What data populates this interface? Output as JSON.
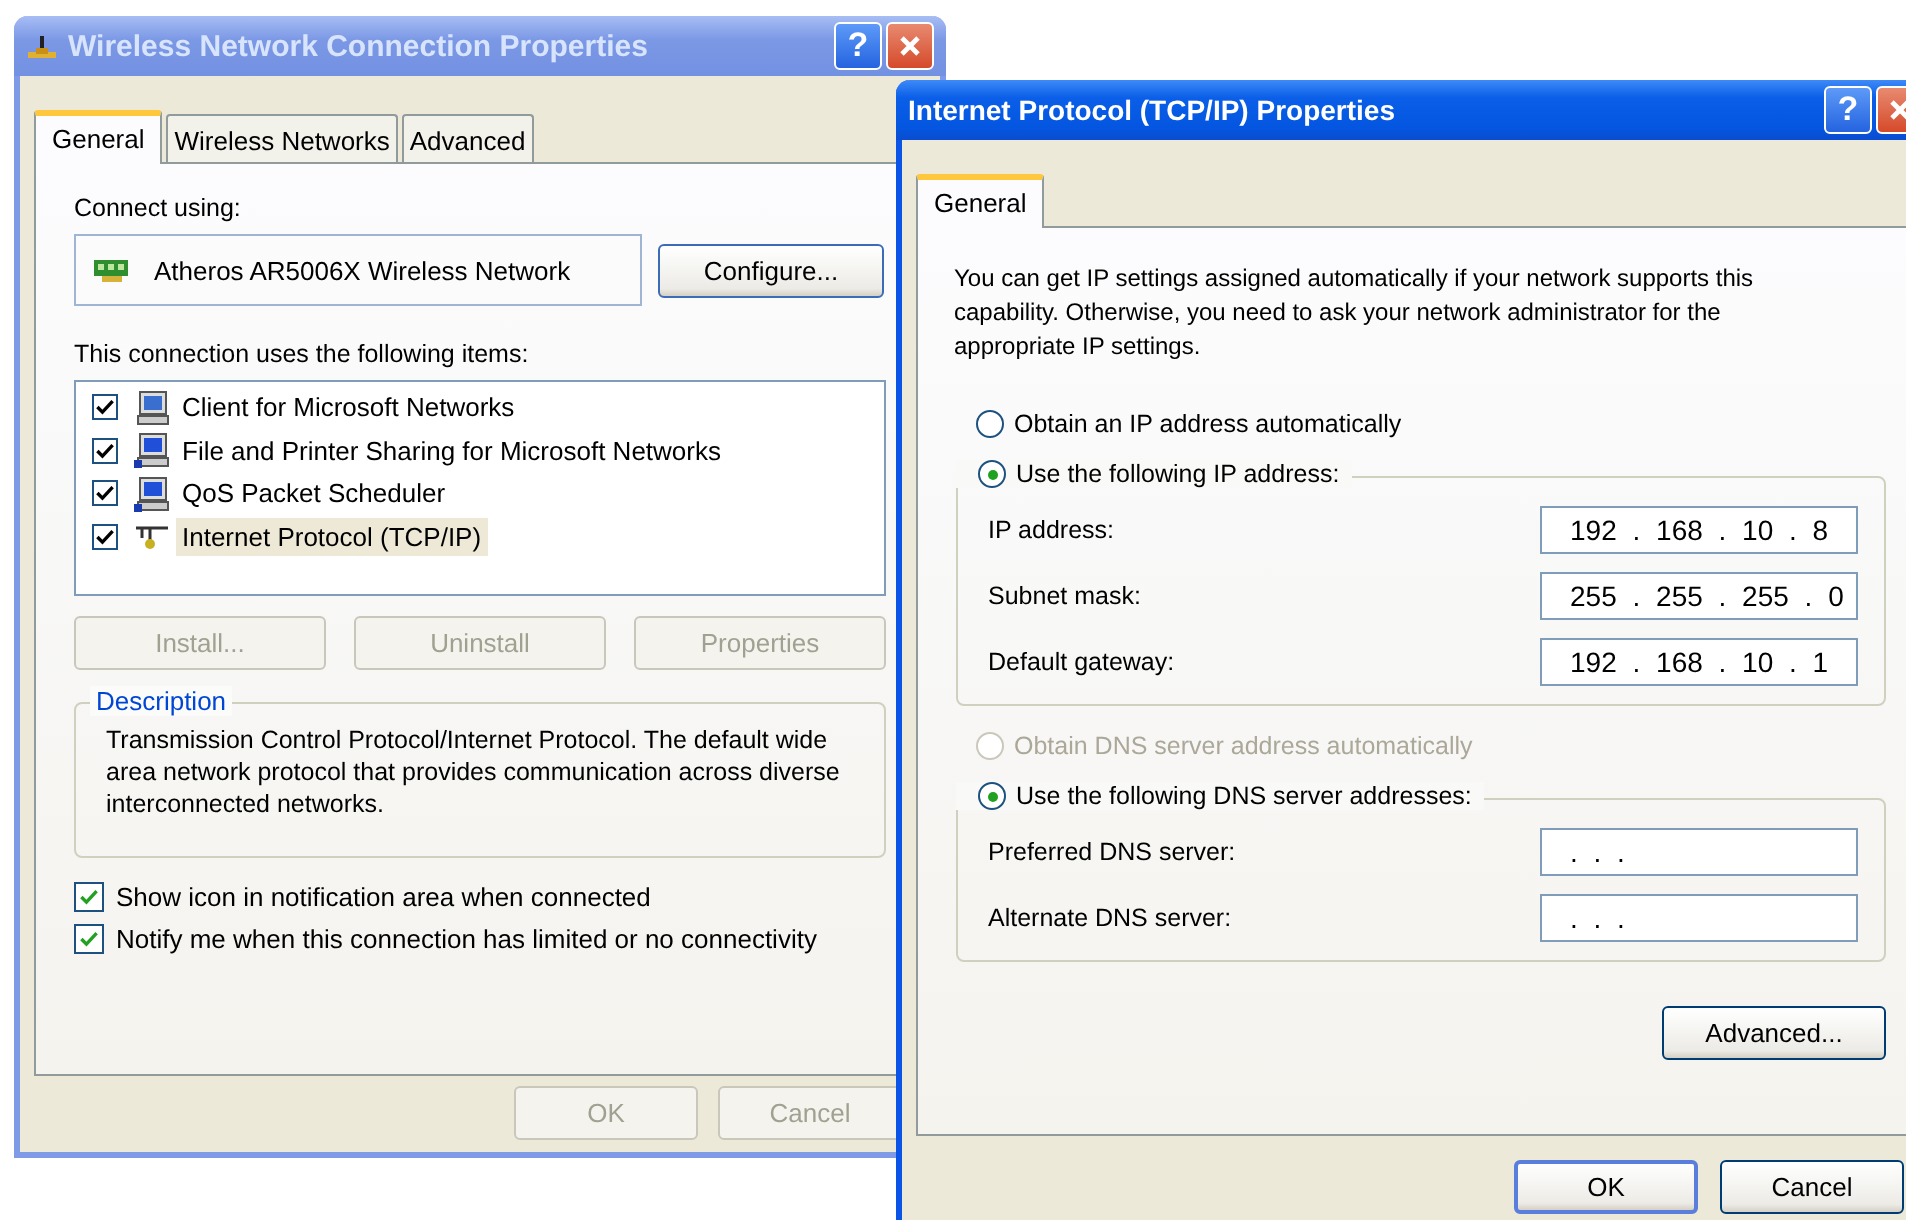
{
  "connection_properties": {
    "title": "Wireless Network Connection Properties",
    "active": false,
    "help": "?",
    "tabs": [
      {
        "label": "General",
        "selected": true
      },
      {
        "label": "Wireless Networks",
        "selected": false
      },
      {
        "label": "Advanced",
        "selected": false
      }
    ],
    "connect_using_label": "Connect using:",
    "adapter": "Atheros AR5006X Wireless Network",
    "configure_button": {
      "label": "Configure...",
      "disabled": false
    },
    "items_label": "This connection uses the following items:",
    "items": [
      {
        "label": "Client for Microsoft Networks",
        "checked": true,
        "selected": false,
        "kind": "client"
      },
      {
        "label": "File and Printer Sharing for Microsoft Networks",
        "checked": true,
        "selected": false,
        "kind": "service"
      },
      {
        "label": "QoS Packet Scheduler",
        "checked": true,
        "selected": false,
        "kind": "service"
      },
      {
        "label": "Internet Protocol (TCP/IP)",
        "checked": true,
        "selected": true,
        "kind": "protocol"
      }
    ],
    "item_buttons": [
      {
        "label": "Install...",
        "disabled": true
      },
      {
        "label": "Uninstall",
        "disabled": true
      },
      {
        "label": "Properties",
        "disabled": true
      }
    ],
    "description": {
      "title": "Description",
      "text": "Transmission Control Protocol/Internet Protocol. The default wide area network protocol that provides communication across diverse interconnected networks."
    },
    "options": [
      {
        "label": "Show icon in notification area when connected",
        "checked": true
      },
      {
        "label": "Notify me when this connection has limited or no connectivity",
        "checked": true
      }
    ],
    "buttons": [
      {
        "label": "OK",
        "disabled": true
      },
      {
        "label": "Cancel",
        "disabled": true
      }
    ]
  },
  "tcpip_properties": {
    "title": "Internet Protocol (TCP/IP) Properties",
    "active": true,
    "help": "?",
    "tabs": [
      {
        "label": "General",
        "selected": true
      }
    ],
    "intro": "You can get IP settings assigned automatically if your network supports this capability. Otherwise, you need to ask your network administrator for the appropriate IP settings.",
    "ip_mode": [
      {
        "label": "Obtain an IP address automatically",
        "selected": false,
        "disabled": false
      },
      {
        "label": "Use the following IP address:",
        "selected": true,
        "disabled": false
      }
    ],
    "ip_fields": [
      {
        "label": "IP address:",
        "value": "192 . 168 . 10 . 8"
      },
      {
        "label": "Subnet mask:",
        "value": "255 . 255 . 255 . 0"
      },
      {
        "label": "Default gateway:",
        "value": "192 . 168 . 10 . 1"
      }
    ],
    "dns_mode": [
      {
        "label": "Obtain DNS server address automatically",
        "selected": false,
        "disabled": true
      },
      {
        "label": "Use the following DNS server addresses:",
        "selected": true,
        "disabled": false
      }
    ],
    "dns_fields": [
      {
        "label": "Preferred DNS server:",
        "value": ". . ."
      },
      {
        "label": "Alternate DNS server:",
        "value": ". . ."
      }
    ],
    "advanced_button": {
      "label": "Advanced...",
      "disabled": false
    },
    "buttons": [
      {
        "label": "OK",
        "disabled": false
      },
      {
        "label": "Cancel",
        "disabled": false
      }
    ]
  }
}
